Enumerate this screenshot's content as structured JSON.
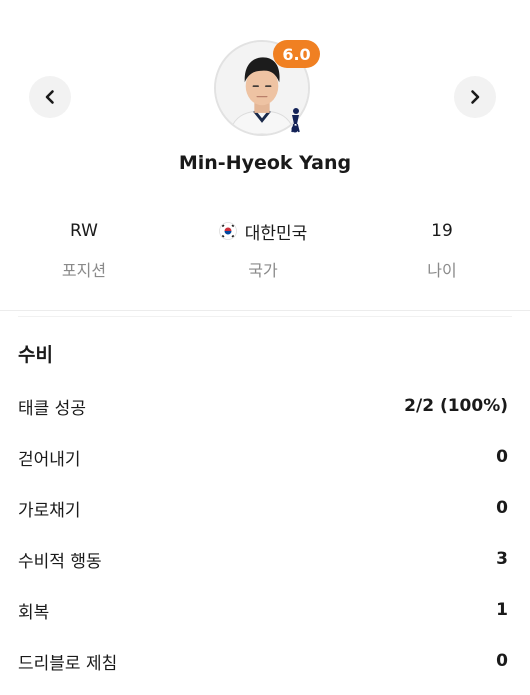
{
  "player": {
    "name": "Min-Hyeok Yang",
    "rating": "6.0",
    "rating_color": "#f08022"
  },
  "nav": {
    "prev_icon": "chevron-left-icon",
    "next_icon": "chevron-right-icon"
  },
  "info": [
    {
      "value": "RW",
      "label": "포지션"
    },
    {
      "value": "대한민국",
      "label": "국가",
      "icon": "south-korea-flag-icon"
    },
    {
      "value": "19",
      "label": "나이"
    }
  ],
  "section": {
    "title": "수비",
    "stats": [
      {
        "label": "태클 성공",
        "value": "2/2 (100%)"
      },
      {
        "label": "걷어내기",
        "value": "0"
      },
      {
        "label": "가로채기",
        "value": "0"
      },
      {
        "label": "수비적 행동",
        "value": "3"
      },
      {
        "label": "회복",
        "value": "1"
      },
      {
        "label": "드리블로 제침",
        "value": "0"
      }
    ]
  }
}
